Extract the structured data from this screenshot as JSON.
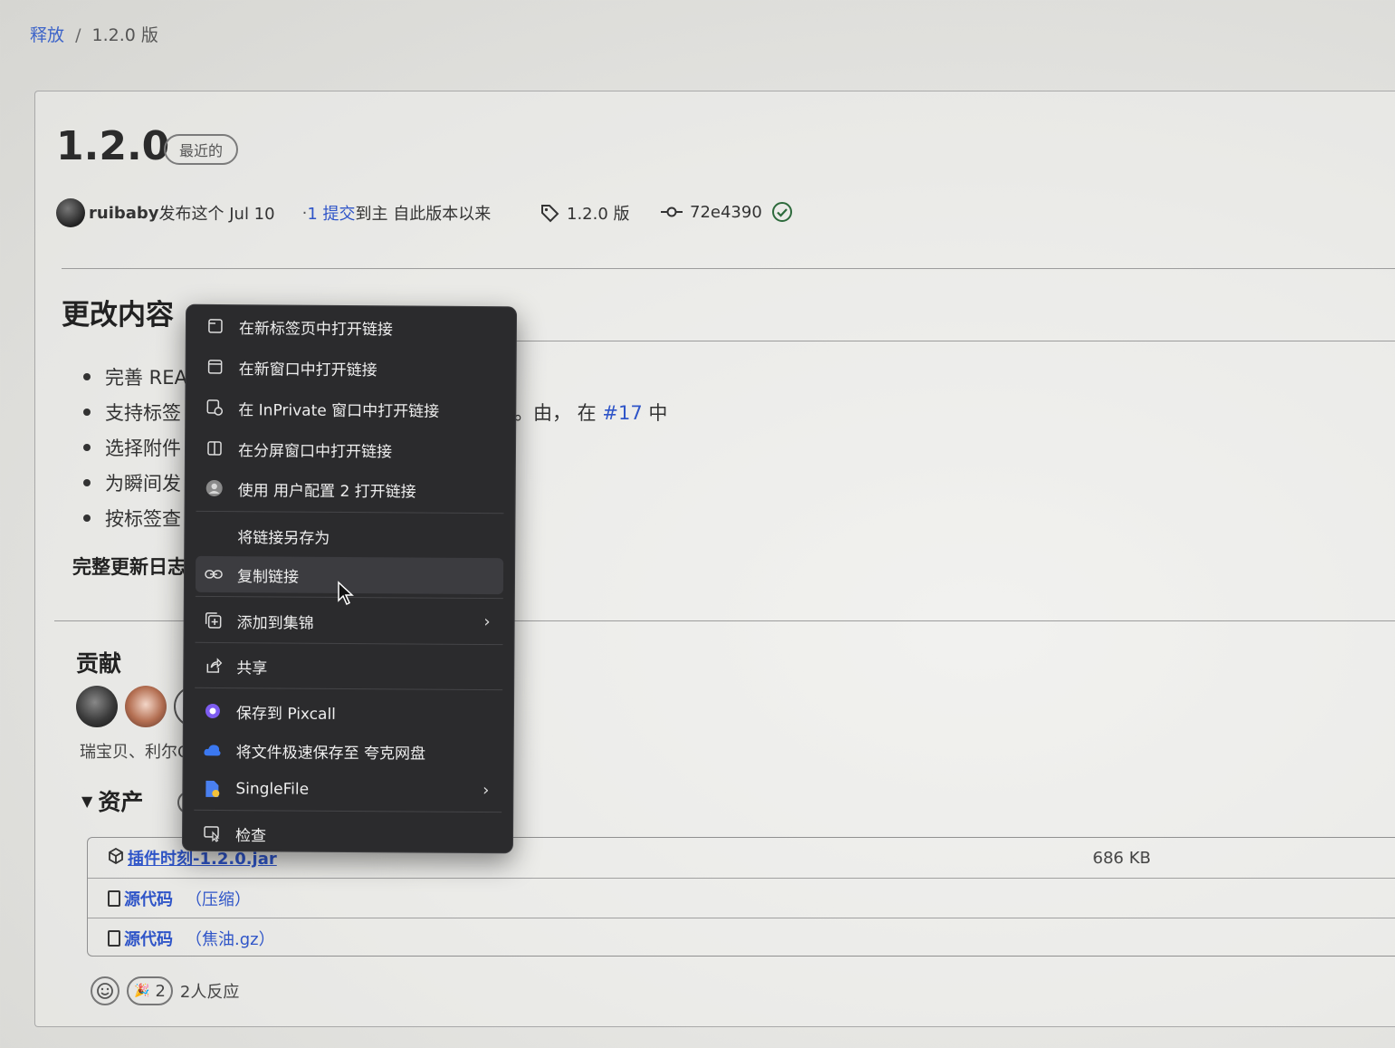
{
  "breadcrumb": {
    "parent": "释放",
    "current": "1.2.0 版"
  },
  "release": {
    "title": "1.2.0",
    "badge": "最近的",
    "author": "ruibaby",
    "published_text": "发布这个 Jul 10",
    "commits_prefix": "· ",
    "commits_count": "1 提交",
    "commits_suffix": "到主 自此版本以来",
    "tag": "1.2.0 版",
    "commit_hash": "72e4390"
  },
  "changes": {
    "title": "更改内容",
    "items": [
      "完善 REA",
      "支持标签",
      "选择附件",
      "为瞬间发",
      "按标签查"
    ],
    "line2_tail_text": "。由， 在",
    "line2_tail_link": "#17",
    "line2_tail_end": "中",
    "full_log": "完整更新日志"
  },
  "contributors": {
    "title": "贡献",
    "names": "瑞宝贝、利尔G"
  },
  "assets": {
    "title": "资产",
    "count": "3",
    "rows": [
      {
        "name": "插件时刻-1.2.0.jar",
        "suffix": "",
        "size": "686 KB"
      },
      {
        "name": "源代码",
        "suffix": "（压缩）",
        "size": ""
      },
      {
        "name": "源代码",
        "suffix": "（焦油.gz）",
        "size": ""
      }
    ]
  },
  "reactions": {
    "count": "2",
    "text": "2人反应"
  },
  "context_menu": {
    "items": [
      {
        "label": "在新标签页中打开链接",
        "icon": "new-tab-icon"
      },
      {
        "label": "在新窗口中打开链接",
        "icon": "new-window-icon"
      },
      {
        "label": "在 InPrivate 窗口中打开链接",
        "icon": "inprivate-icon"
      },
      {
        "label": "在分屏窗口中打开链接",
        "icon": "split-screen-icon"
      },
      {
        "label": "使用 用户配置 2 打开链接",
        "icon": "profile-icon"
      },
      {
        "label": "将链接另存为",
        "icon": ""
      },
      {
        "label": "复制链接",
        "icon": "link-icon"
      },
      {
        "label": "添加到集锦",
        "icon": "collections-icon"
      },
      {
        "label": "共享",
        "icon": "share-icon"
      },
      {
        "label": "保存到 Pixcall",
        "icon": "pixcall-icon"
      },
      {
        "label": "将文件极速保存至 夸克网盘",
        "icon": "quark-cloud-icon"
      },
      {
        "label": "SingleFile",
        "icon": "singlefile-icon"
      },
      {
        "label": "检查",
        "icon": "inspect-icon"
      }
    ]
  }
}
